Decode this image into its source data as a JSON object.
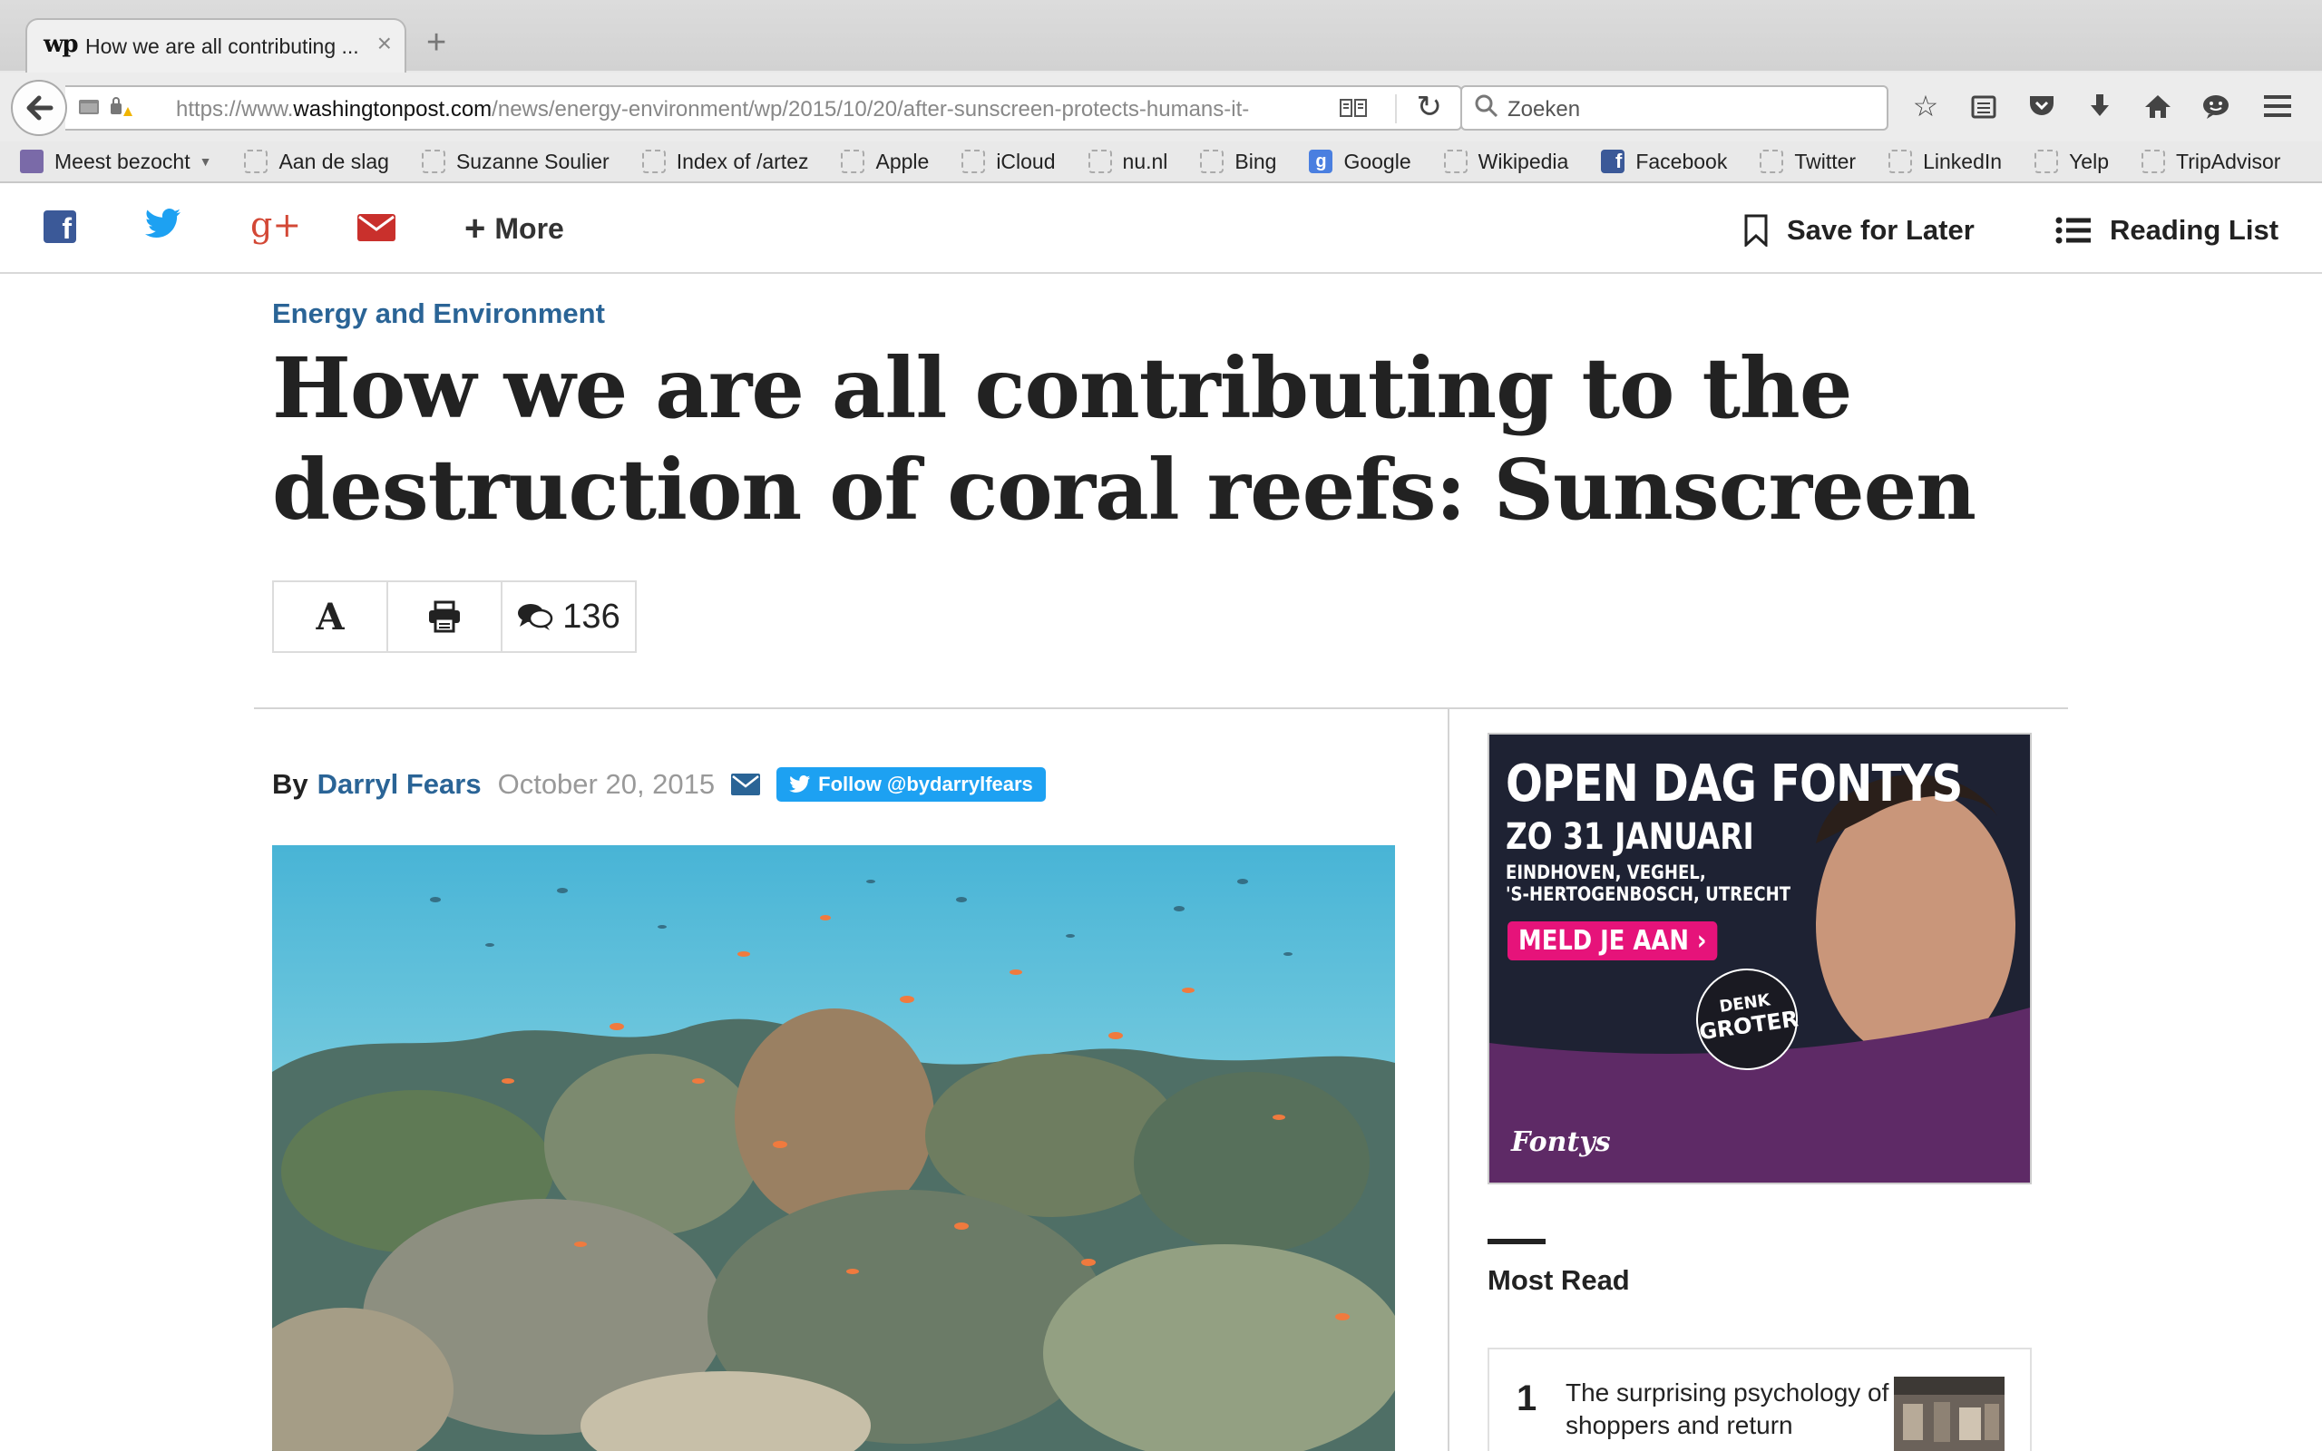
{
  "browser": {
    "tab_title": "How we are all contributing ...",
    "url_prefix": "https://www.",
    "url_host": "washingtonpost.com",
    "url_path": "/news/energy-environment/wp/2015/10/20/after-sunscreen-protects-humans-it-",
    "search_placeholder": "Zoeken",
    "bookmarks": [
      {
        "label": "Meest bezocht",
        "icon": "folder-icon"
      },
      {
        "label": "Aan de slag",
        "icon": "page-icon"
      },
      {
        "label": "Suzanne Soulier",
        "icon": "page-icon"
      },
      {
        "label": "Index of /artez",
        "icon": "page-icon"
      },
      {
        "label": "Apple",
        "icon": "page-icon"
      },
      {
        "label": "iCloud",
        "icon": "page-icon"
      },
      {
        "label": "nu.nl",
        "icon": "page-icon"
      },
      {
        "label": "Bing",
        "icon": "page-icon"
      },
      {
        "label": "Google",
        "icon": "google-icon"
      },
      {
        "label": "Wikipedia",
        "icon": "page-icon"
      },
      {
        "label": "Facebook",
        "icon": "facebook-icon"
      },
      {
        "label": "Twitter",
        "icon": "page-icon"
      },
      {
        "label": "LinkedIn",
        "icon": "page-icon"
      },
      {
        "label": "Yelp",
        "icon": "page-icon"
      },
      {
        "label": "TripAdvisor",
        "icon": "page-icon"
      }
    ]
  },
  "sharebar": {
    "more_label": "More",
    "save_label": "Save for Later",
    "reading_list_label": "Reading List"
  },
  "article": {
    "kicker": "Energy and Environment",
    "headline": "How we are all contributing to the destruction of coral reefs: Sunscreen",
    "font_tool": "A",
    "comment_count": "136",
    "by_label": "By",
    "author": "Darryl Fears",
    "date": "October 20, 2015",
    "follow_label": "Follow @bydarrylfears"
  },
  "ad": {
    "headline": "OPEN DAG FONTYS",
    "date_line": "ZO 31 JANUARI",
    "cities_line1": "EINDHOVEN, VEGHEL,",
    "cities_line2": "'S-HERTOGENBOSCH, UTRECHT",
    "cta": "MELD JE AAN",
    "badge_line1": "DENK",
    "badge_line2": "GROTER",
    "logo": "Fontys"
  },
  "most_read": {
    "title": "Most Read",
    "items": [
      {
        "rank": "1",
        "text": "The surprising psychology of shoppers and return"
      }
    ]
  },
  "colors": {
    "link_blue": "#2a6496",
    "facebook_blue": "#3b5998",
    "twitter_blue": "#1da1f2",
    "google_red": "#d34836",
    "email_red": "#c9302c",
    "ad_purple": "#5e2a66",
    "ad_pink": "#e6137a"
  }
}
